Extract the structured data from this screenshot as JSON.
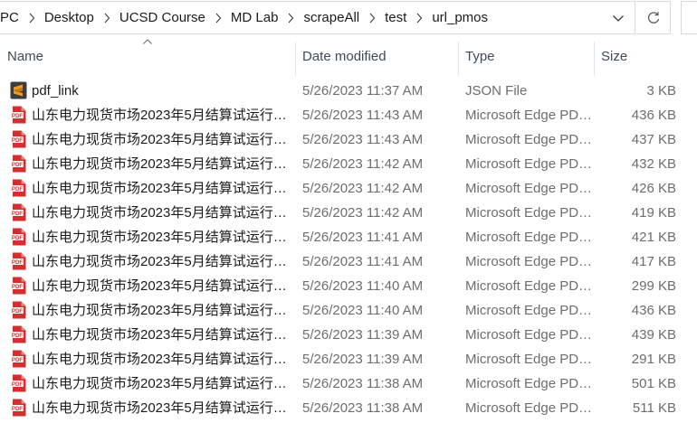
{
  "address_bar": {
    "crumbs": [
      "PC",
      "Desktop",
      "UCSD Course",
      "MD Lab",
      "scrapeAll",
      "test",
      "url_pmos"
    ],
    "dropdown_icon": "chevron-down-icon",
    "refresh_icon": "refresh-icon"
  },
  "columns": {
    "name": "Name",
    "date_modified": "Date modified",
    "type": "Type",
    "size": "Size",
    "sort_indicator": "sort-ascending-icon"
  },
  "files": [
    {
      "icon": "sublime-json-file-icon",
      "name": "pdf_link",
      "date": "5/26/2023 11:37 AM",
      "type": "JSON File",
      "size": "3 KB"
    },
    {
      "icon": "pdf-file-icon",
      "name": "山东电力现货市场2023年5月结算试运行…",
      "date": "5/26/2023 11:43 AM",
      "type": "Microsoft Edge PD…",
      "size": "436 KB"
    },
    {
      "icon": "pdf-file-icon",
      "name": "山东电力现货市场2023年5月结算试运行…",
      "date": "5/26/2023 11:43 AM",
      "type": "Microsoft Edge PD…",
      "size": "437 KB"
    },
    {
      "icon": "pdf-file-icon",
      "name": "山东电力现货市场2023年5月结算试运行…",
      "date": "5/26/2023 11:42 AM",
      "type": "Microsoft Edge PD…",
      "size": "432 KB"
    },
    {
      "icon": "pdf-file-icon",
      "name": "山东电力现货市场2023年5月结算试运行…",
      "date": "5/26/2023 11:42 AM",
      "type": "Microsoft Edge PD…",
      "size": "426 KB"
    },
    {
      "icon": "pdf-file-icon",
      "name": "山东电力现货市场2023年5月结算试运行…",
      "date": "5/26/2023 11:42 AM",
      "type": "Microsoft Edge PD…",
      "size": "419 KB"
    },
    {
      "icon": "pdf-file-icon",
      "name": "山东电力现货市场2023年5月结算试运行…",
      "date": "5/26/2023 11:41 AM",
      "type": "Microsoft Edge PD…",
      "size": "421 KB"
    },
    {
      "icon": "pdf-file-icon",
      "name": "山东电力现货市场2023年5月结算试运行…",
      "date": "5/26/2023 11:41 AM",
      "type": "Microsoft Edge PD…",
      "size": "417 KB"
    },
    {
      "icon": "pdf-file-icon",
      "name": "山东电力现货市场2023年5月结算试运行…",
      "date": "5/26/2023 11:40 AM",
      "type": "Microsoft Edge PD…",
      "size": "299 KB"
    },
    {
      "icon": "pdf-file-icon",
      "name": "山东电力现货市场2023年5月结算试运行…",
      "date": "5/26/2023 11:40 AM",
      "type": "Microsoft Edge PD…",
      "size": "436 KB"
    },
    {
      "icon": "pdf-file-icon",
      "name": "山东电力现货市场2023年5月结算试运行…",
      "date": "5/26/2023 11:39 AM",
      "type": "Microsoft Edge PD…",
      "size": "439 KB"
    },
    {
      "icon": "pdf-file-icon",
      "name": "山东电力现货市场2023年5月结算试运行…",
      "date": "5/26/2023 11:39 AM",
      "type": "Microsoft Edge PD…",
      "size": "291 KB"
    },
    {
      "icon": "pdf-file-icon",
      "name": "山东电力现货市场2023年5月结算试运行…",
      "date": "5/26/2023 11:38 AM",
      "type": "Microsoft Edge PD…",
      "size": "501 KB"
    },
    {
      "icon": "pdf-file-icon",
      "name": "山东电力现货市场2023年5月结算试运行…",
      "date": "5/26/2023 11:38 AM",
      "type": "Microsoft Edge PD…",
      "size": "511 KB"
    }
  ],
  "colors": {
    "pdf_red": "#d32f2f",
    "sublime_dark": "#3d3d3d",
    "sublime_orange": "#f29b1f",
    "muted_text": "#6d6d6d",
    "header_text": "#3c4a5a"
  }
}
